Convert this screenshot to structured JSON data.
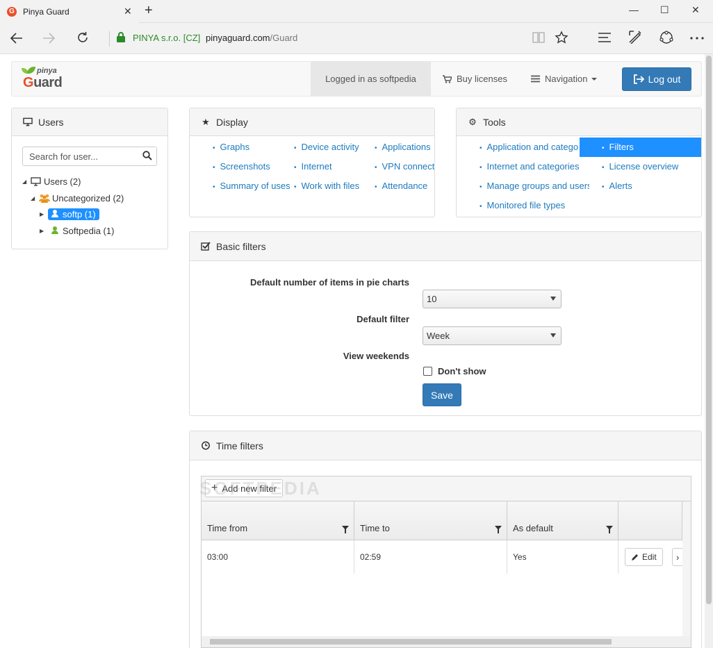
{
  "browser": {
    "tab_title": "Pinya Guard",
    "favicon_letter": "G",
    "close_glyph": "✕",
    "new_tab_glyph": "+",
    "minimize_glyph": "—",
    "maximize_glyph": "☐",
    "window_close_glyph": "✕",
    "cert": "PINYA s.r.o. [CZ]",
    "url_host": "pinyaguard.com",
    "url_path": "/Guard",
    "accent_green": "#2a8a2a"
  },
  "logo": {
    "small": "pinya",
    "big_first": "G",
    "big_rest": "uard"
  },
  "navbar": {
    "logged_in": "Logged in as softpedia",
    "buy": "Buy licenses",
    "navigation": "Navigation",
    "logout": "Log out"
  },
  "users_panel": {
    "title": "Users",
    "search_placeholder": "Search for user...",
    "tree": [
      {
        "label": "Users (2)",
        "icon": "monitor-icon"
      },
      {
        "label": "Uncategorized (2)",
        "icon": "group-icon"
      },
      {
        "label": "softp (1)",
        "icon": "user-icon",
        "selected": true
      },
      {
        "label": "Softpedia (1)",
        "icon": "user-icon"
      }
    ]
  },
  "display_panel": {
    "title": "Display",
    "links": [
      "Graphs",
      "Screenshots",
      "Summary of uses",
      "Device activity",
      "Internet",
      "Work with files",
      "Applications",
      "VPN connections",
      "Attendance"
    ]
  },
  "tools_panel": {
    "title": "Tools",
    "links": [
      "Application and categories",
      "Internet and categories",
      "Manage groups and users",
      "Monitored file types",
      "Filters",
      "License overview",
      "Alerts"
    ],
    "active": "Filters"
  },
  "basic_filters": {
    "title": "Basic filters",
    "pie_label": "Default number of items in pie charts",
    "pie_value": "10",
    "filter_label": "Default filter",
    "filter_value": "Week",
    "weekends_label": "View weekends",
    "weekends_option": "Don't show",
    "weekends_checked": false,
    "save": "Save"
  },
  "time_filters": {
    "title": "Time filters",
    "add_button": "Add new filter",
    "columns": [
      "Time from",
      "Time to",
      "As default"
    ],
    "rows": [
      {
        "from": "03:00",
        "to": "02:59",
        "default": "Yes",
        "edit": "Edit"
      }
    ]
  },
  "watermark": "SOFTPEDIA",
  "colors": {
    "primary": "#337ab7",
    "link": "#1d7bbf",
    "selected": "#1e90ff"
  }
}
